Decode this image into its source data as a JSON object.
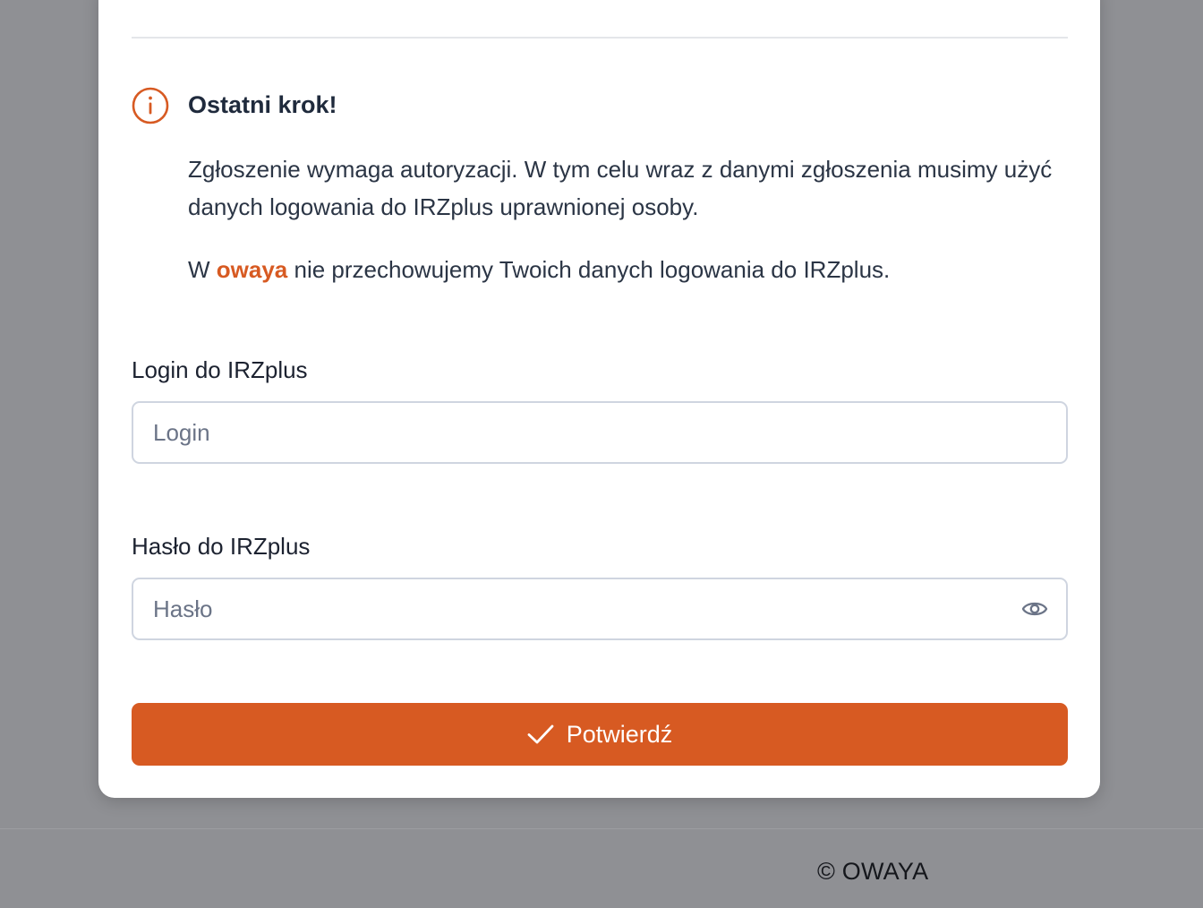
{
  "notice": {
    "title": "Ostatni krok!",
    "paragraph1": "Zgłoszenie wymaga autoryzacji. W tym celu wraz z danymi zgłoszenia musimy użyć danych logowania do IRZplus uprawnionej osoby.",
    "paragraph2_prefix": "W ",
    "paragraph2_brand": "owaya",
    "paragraph2_suffix": " nie przechowujemy Twoich danych logowania do IRZplus.",
    "icon": "info-circle-icon"
  },
  "form": {
    "login_label": "Login do IRZplus",
    "login_placeholder": "Login",
    "login_value": "",
    "password_label": "Hasło do IRZplus",
    "password_placeholder": "Hasło",
    "password_value": "",
    "password_toggle_icon": "eye-icon",
    "submit_label": "Potwierdź",
    "submit_icon": "check-icon"
  },
  "footer": {
    "copyright": "© OWAYA"
  },
  "colors": {
    "accent": "#d75a22",
    "backdrop": "#8f9094",
    "text": "#1f2a3c"
  }
}
